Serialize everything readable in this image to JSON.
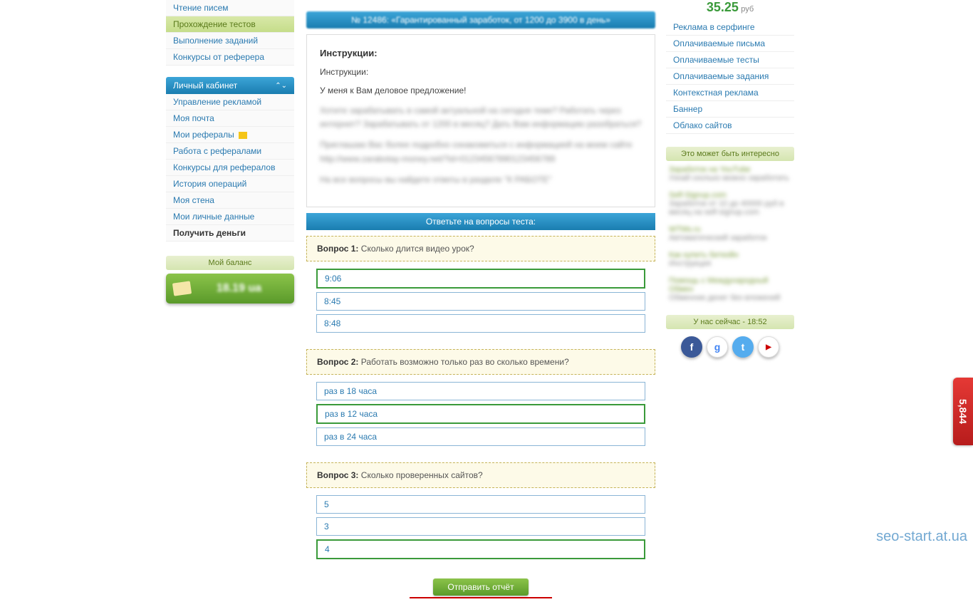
{
  "left_menu_top": [
    {
      "label": "Чтение писем",
      "active": false
    },
    {
      "label": "Прохождение тестов",
      "active": true
    },
    {
      "label": "Выполнение заданий",
      "active": false
    },
    {
      "label": "Конкурсы от реферера",
      "active": false
    }
  ],
  "personal_cabinet": {
    "title": "Личный кабинет",
    "items": [
      {
        "label": "Управление рекламой"
      },
      {
        "label": "Моя почта"
      },
      {
        "label": "Мои рефералы",
        "icon": true
      },
      {
        "label": "Работа с рефералами"
      },
      {
        "label": "Конкурсы для рефералов"
      },
      {
        "label": "История операций"
      },
      {
        "label": "Моя стена"
      },
      {
        "label": "Мои личные данные"
      },
      {
        "label": "Получить деньги",
        "bold": true
      }
    ]
  },
  "balance": {
    "label": "Мой баланс",
    "amount": "18.19 ua"
  },
  "main": {
    "header_blurred": "№ 12486: «Гарантированный заработок, от 1200 до 3900 в день»",
    "instructions_title": "Инструкции:",
    "instructions_sub": "Инструкции:",
    "instructions_text": "У меня к Вам деловое предложение!",
    "blurred1": "Хотите зарабатывать в самой актуальной на сегодня теме? Работать через интернет? Зарабатывать от 1200 в месяц? Дать Вам информацию разобраться?",
    "blurred2": "Приглашаю Вас более подробно ознакомиться с информацией на моем сайте http://www.zarabotay-money.net/?id=01234567890123456789",
    "blurred3": "На все вопросы вы найдете ответы в разделе \"К РАБОТЕ\"",
    "test_header": "Ответьте на вопросы теста:",
    "questions": [
      {
        "label": "Вопрос 1:",
        "text": "Сколько длится видео урок?",
        "answers": [
          "9:06",
          "8:45",
          "8:48"
        ],
        "selected": 0
      },
      {
        "label": "Вопрос 2:",
        "text": "Работать возможно только раз во сколько времени?",
        "answers": [
          "раз в 18 часа",
          "раз в 12 часа",
          "раз в 24 часа"
        ],
        "selected": 1
      },
      {
        "label": "Вопрос 3:",
        "text": "Сколько проверенных сайтов?",
        "answers": [
          "5",
          "3",
          "4"
        ],
        "selected": 2
      }
    ],
    "submit": "Отправить отчёт"
  },
  "right": {
    "price": "35.25",
    "currency": "руб",
    "menu": [
      "Реклама в серфинге",
      "Оплачиваемые письма",
      "Оплачиваемые тесты",
      "Оплачиваемые задания",
      "Контекстная реклама",
      "Баннер",
      "Облако сайтов"
    ],
    "interest_title": "Это может быть интересно",
    "interest_items": [
      {
        "t": "Заработок на YouTube",
        "d": "Узнай сколько можно заработать"
      },
      {
        "t": "Self-Signup.com",
        "d": "Заработок от 10 до 40000 руб в месяц на self-signup.com"
      },
      {
        "t": "WTMs.ru",
        "d": "Автоматический заработок"
      },
      {
        "t": "Как купить биткойн",
        "d": "Инструкция"
      },
      {
        "t": "Помощь с Международный Обмен",
        "d": "Обменник денег без вложений"
      }
    ],
    "time_label": "У нас сейчас - 18:52"
  },
  "badge": "5,844",
  "watermark": "seo-start.at.ua"
}
